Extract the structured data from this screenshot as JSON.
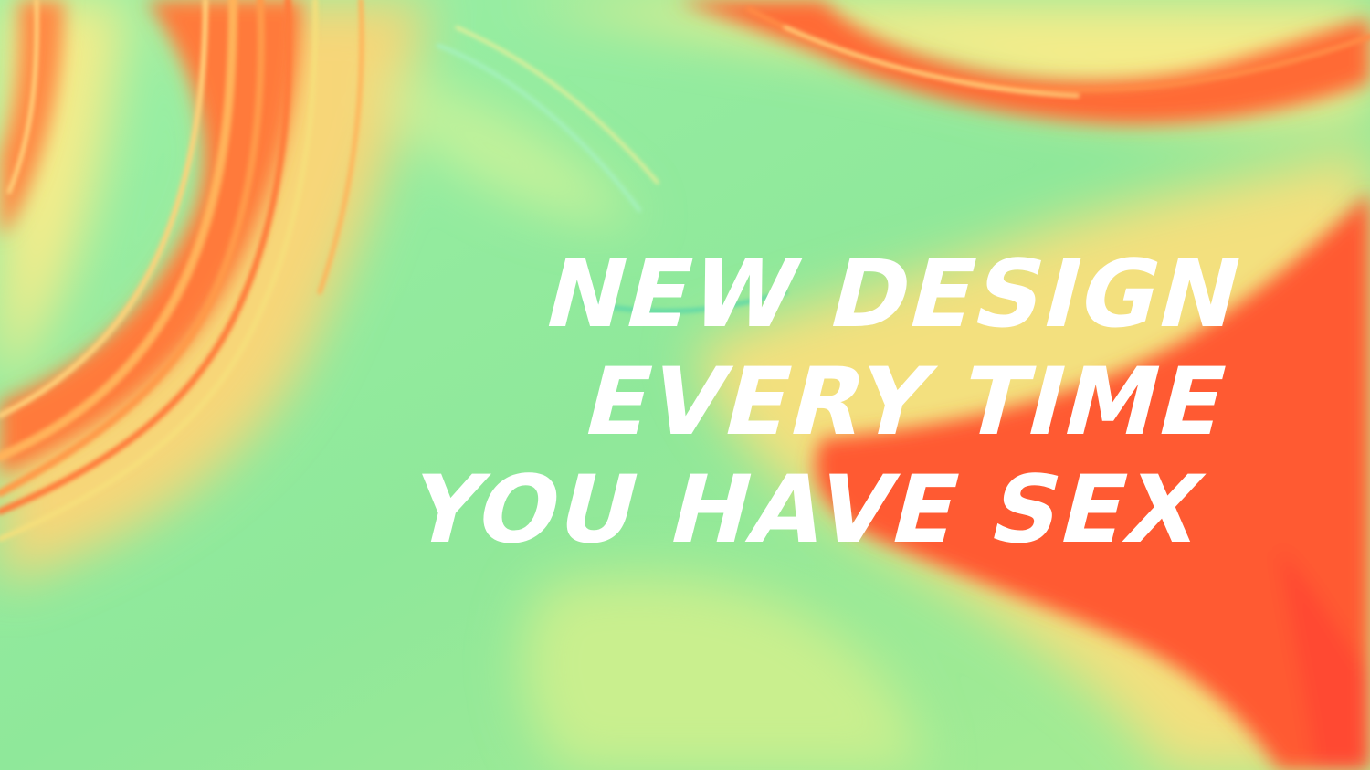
{
  "headline": {
    "line_1": "NEW DESIGN",
    "line_2": "EVERY TIME",
    "line_3": "YOU HAVE SEX"
  },
  "colors": {
    "mint_green": "#8fe89a",
    "pale_yellow": "#f2f08a",
    "orange": "#ff7a3a",
    "red_orange": "#ff4a30",
    "text": "#ffffff"
  }
}
